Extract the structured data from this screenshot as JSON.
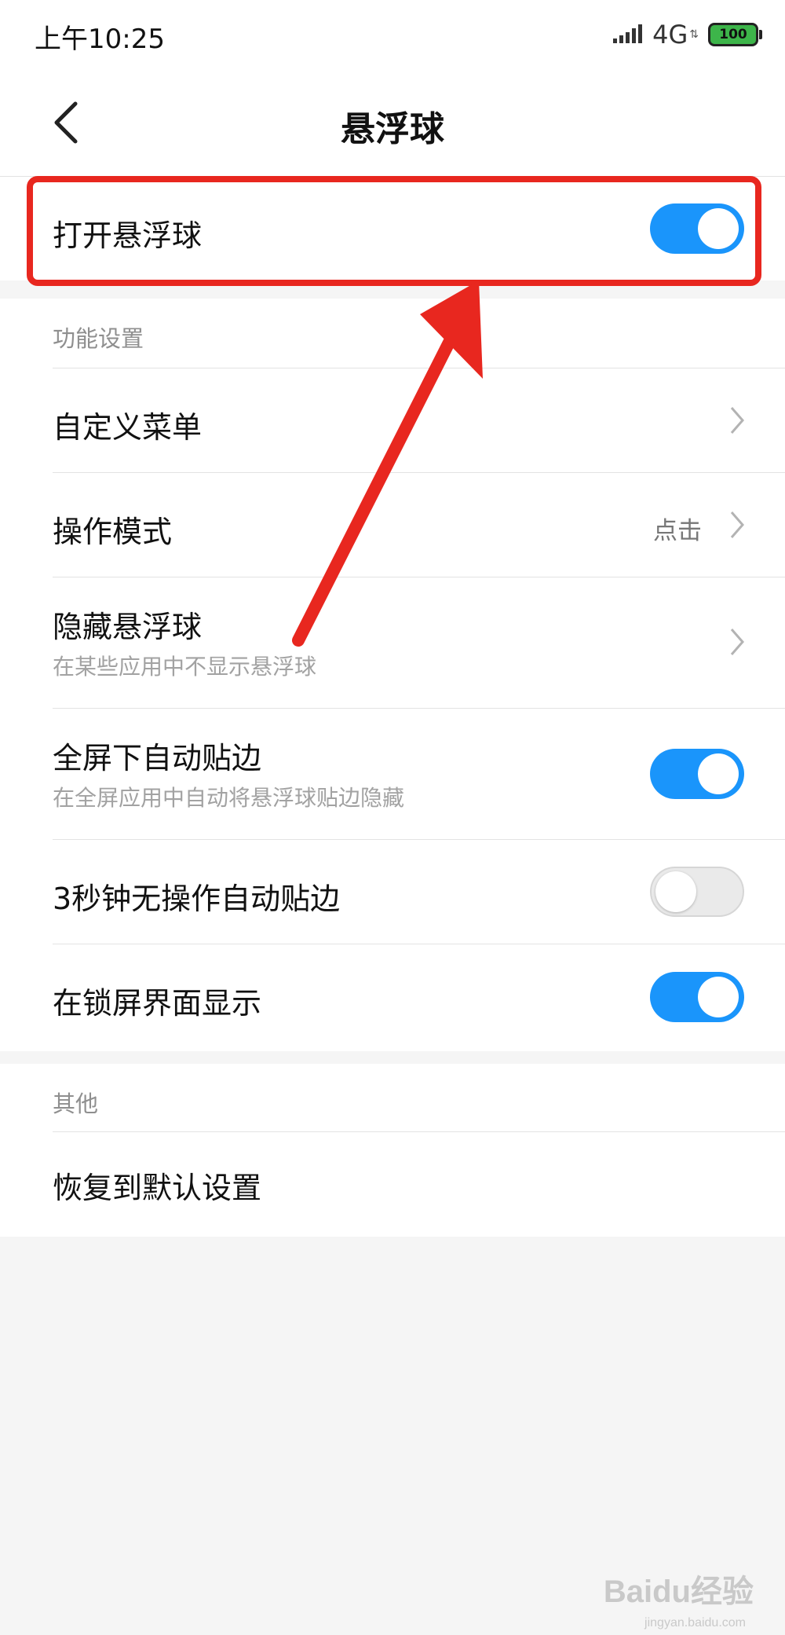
{
  "status_bar": {
    "time": "上午10:25",
    "network": "4G",
    "battery": "100"
  },
  "header": {
    "title": "悬浮球"
  },
  "main_toggle": {
    "label": "打开悬浮球",
    "enabled": true
  },
  "function_settings": {
    "section_label": "功能设置",
    "custom_menu": {
      "label": "自定义菜单"
    },
    "operation_mode": {
      "label": "操作模式",
      "value": "点击"
    },
    "hide_ball": {
      "label": "隐藏悬浮球",
      "sub": "在某些应用中不显示悬浮球"
    },
    "fullscreen_edge": {
      "label": "全屏下自动贴边",
      "sub": "在全屏应用中自动将悬浮球贴边隐藏",
      "enabled": true
    },
    "idle_edge": {
      "label": "3秒钟无操作自动贴边",
      "enabled": false
    },
    "lockscreen": {
      "label": "在锁屏界面显示",
      "enabled": true
    }
  },
  "other": {
    "section_label": "其他",
    "restore_defaults": {
      "label": "恢复到默认设置"
    }
  },
  "watermark": {
    "logo": "Baidu经验",
    "domain": "jingyan.baidu.com"
  },
  "colors": {
    "accent": "#1a95fb",
    "annotation": "#e8271f"
  }
}
